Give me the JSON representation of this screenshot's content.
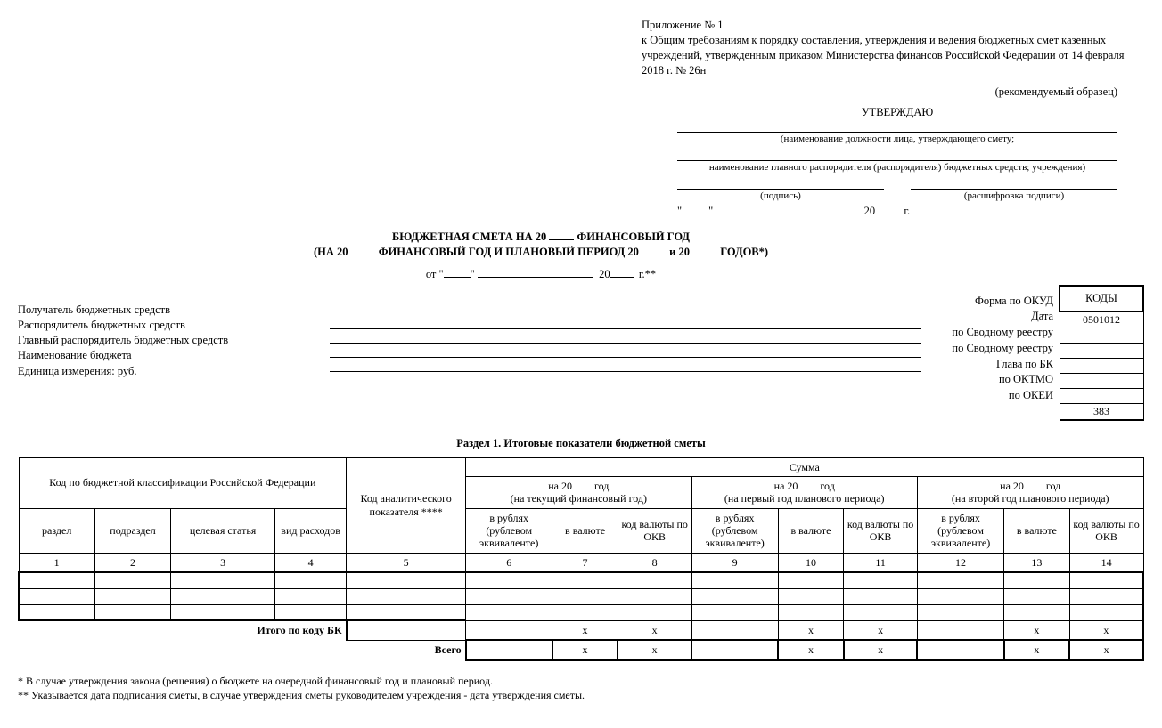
{
  "appendix": {
    "line1": "Приложение № 1",
    "line2": "к Общим требованиям к порядку составления, утверждения и ведения бюджетных смет казенных учреждений, утвержденным приказом Министерства финансов Российской Федерации  от 14 февраля 2018 г. № 26н"
  },
  "recommended": "(рекомендуемый образец)",
  "approve": {
    "title": "УТВЕРЖДАЮ",
    "hint1": "(наименование должности лица, утверждающего смету;",
    "hint2": "наименование главного распорядителя (распорядителя) бюджетных средств; учреждения)",
    "sig_hint": "(подпись)",
    "decode_hint": "(расшифровка подписи)",
    "date_prefix": "\"",
    "date_mid": "\"",
    "year_prefix": "20",
    "year_suffix": "г."
  },
  "title": {
    "line1a": "БЮДЖЕТНАЯ СМЕТА НА 20 ",
    "line1b": "  ФИНАНСОВЫЙ ГОД",
    "line2a": "(НА 20 ",
    "line2b": "  ФИНАНСОВЫЙ ГОД И ПЛАНОВЫЙ ПЕРИОД  20 ",
    "line2c": "  и 20 ",
    "line2d": "  ГОДОВ*)",
    "subdate_a": "от \"",
    "subdate_b": "\"",
    "subdate_c": "20",
    "subdate_d": "г.**"
  },
  "meta_left": {
    "l1": "Получатель бюджетных средств",
    "l2": "Распорядитель бюджетных средств",
    "l3": "Главный распорядитель бюджетных средств",
    "l4": "Наименование бюджета",
    "l5": "Единица измерения: руб."
  },
  "meta_right": {
    "r0": "Форма по ОКУД",
    "r1": "Дата",
    "r2": "по Сводному реестру",
    "r3": "по Сводному реестру",
    "r4": "Глава по БК",
    "r5": "по ОКТМО",
    "r6": "по ОКЕИ"
  },
  "codes": {
    "header": "КОДЫ",
    "okud": "0501012",
    "date": "",
    "sv1": "",
    "sv2": "",
    "glava": "",
    "oktmo": "",
    "okei": "383"
  },
  "section1": "Раздел 1. Итоговые показатели бюджетной сметы",
  "table": {
    "h_kbk": "Код по бюджетной классификации Российской Федерации",
    "h_anal": "Код аналитического показателя ****",
    "h_sum": "Сумма",
    "h_y1a": "на 20",
    "h_y1b": "год",
    "h_y1_sub": "(на текущий финансовый год)",
    "h_y2_sub": "(на первый год планового периода)",
    "h_y3_sub": "(на второй год планового периода)",
    "c_razdel": "раздел",
    "c_podrazdel": "подраздел",
    "c_cs": "целевая статья",
    "c_vr": "вид расходов",
    "c_rub": "в рублях (рублевом эквиваленте)",
    "c_val": "в валюте",
    "c_okv": "код валюты по ОКВ",
    "nums": [
      "1",
      "2",
      "3",
      "4",
      "5",
      "6",
      "7",
      "8",
      "9",
      "10",
      "11",
      "12",
      "13",
      "14"
    ],
    "itogo": "Итого по коду БК",
    "vsego": "Всего",
    "x": "x"
  },
  "footnotes": {
    "f1": "* В случае утверждения закона (решения) о бюджете на очередной финансовый год и плановый период.",
    "f2": "** Указывается дата подписания сметы, в случае утверждения сметы руководителем учреждения - дата утверждения сметы."
  }
}
